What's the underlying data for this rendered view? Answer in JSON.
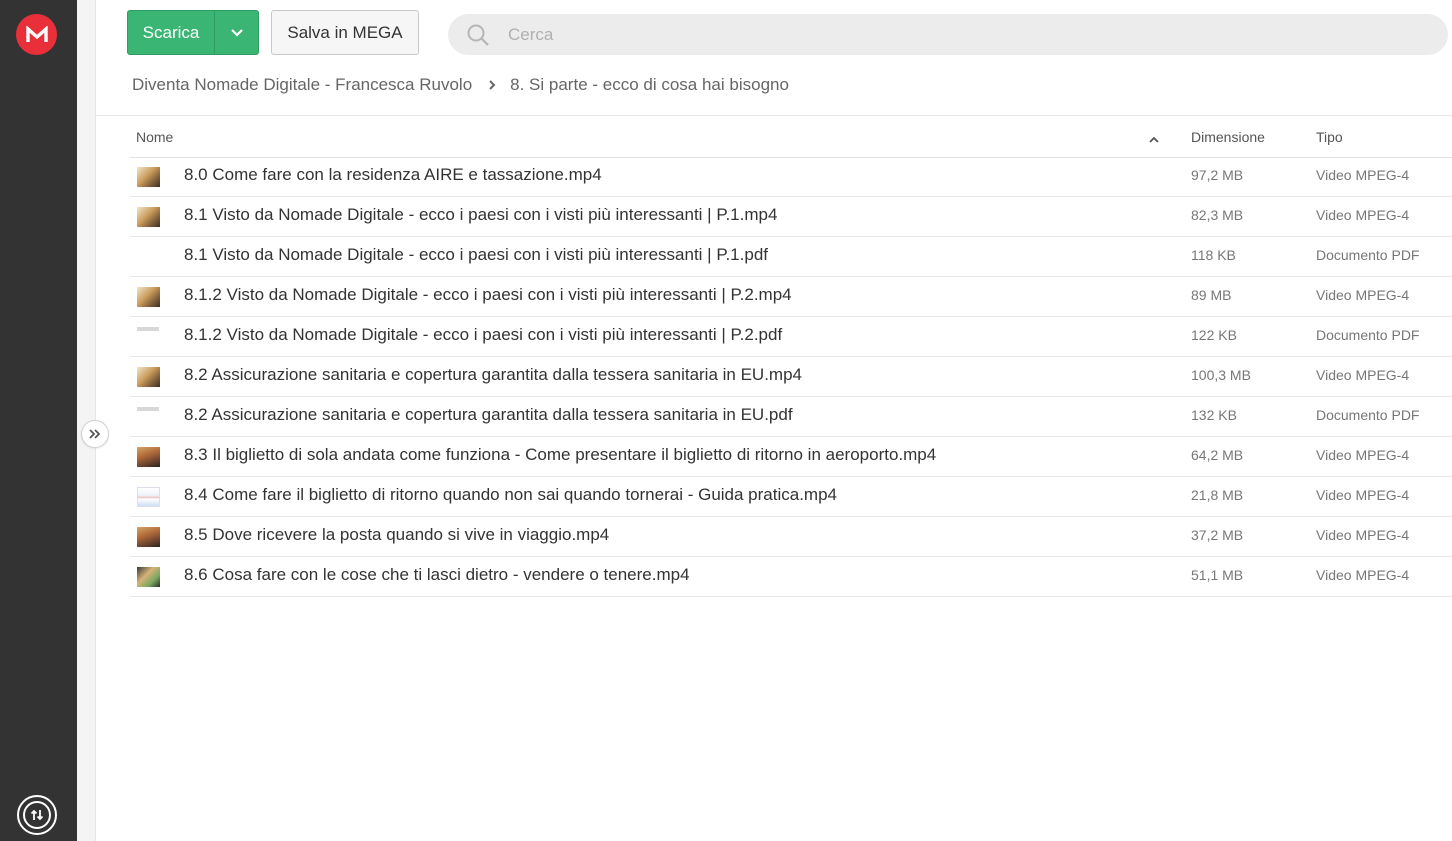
{
  "toolbar": {
    "download_label": "Scarica",
    "save_label": "Salva in MEGA",
    "search_placeholder": "Cerca"
  },
  "breadcrumb": {
    "root": "Diventa Nomade Digitale - Francesca Ruvolo",
    "current": "8. Si parte - ecco di cosa hai bisogno"
  },
  "table": {
    "headers": {
      "name": "Nome",
      "size": "Dimensione",
      "type": "Tipo"
    },
    "sort": "ascending",
    "rows": [
      {
        "name": "8.0 Come fare con la residenza AIRE e tassazione.mp4",
        "size": "97,2 MB",
        "type": "Video MPEG-4",
        "thumb": "video"
      },
      {
        "name": "8.1 Visto da Nomade Digitale - ecco i paesi con i visti più interessanti | P.1.mp4",
        "size": "82,3 MB",
        "type": "Video MPEG-4",
        "thumb": "video"
      },
      {
        "name": "8.1 Visto da Nomade Digitale - ecco i paesi con i visti più interessanti | P.1.pdf",
        "size": "118 KB",
        "type": "Documento PDF",
        "thumb": "none"
      },
      {
        "name": "8.1.2 Visto da Nomade Digitale - ecco i paesi con i visti più interessanti | P.2.mp4",
        "size": "89 MB",
        "type": "Video MPEG-4",
        "thumb": "video"
      },
      {
        "name": "8.1.2 Visto da Nomade Digitale - ecco i paesi con i visti più interessanti | P.2.pdf",
        "size": "122 KB",
        "type": "Documento PDF",
        "thumb": "pdf"
      },
      {
        "name": "8.2 Assicurazione sanitaria e copertura garantita dalla tessera sanitaria in EU.mp4",
        "size": "100,3 MB",
        "type": "Video MPEG-4",
        "thumb": "video"
      },
      {
        "name": "8.2 Assicurazione sanitaria e copertura garantita dalla tessera sanitaria in EU.pdf",
        "size": "132 KB",
        "type": "Documento PDF",
        "thumb": "pdf"
      },
      {
        "name": "8.3 Il biglietto di sola andata come funziona - Come presentare il biglietto di ritorno in aeroporto.mp4",
        "size": "64,2 MB",
        "type": "Video MPEG-4",
        "thumb": "video2"
      },
      {
        "name": "8.4 Come fare il biglietto di ritorno quando non sai quando tornerai - Guida pratica.mp4",
        "size": "21,8 MB",
        "type": "Video MPEG-4",
        "thumb": "video3"
      },
      {
        "name": "8.5 Dove ricevere la posta quando si vive in viaggio.mp4",
        "size": "37,2 MB",
        "type": "Video MPEG-4",
        "thumb": "video2"
      },
      {
        "name": "8.6 Cosa fare con le cose che ti lasci dietro - vendere o tenere.mp4",
        "size": "51,1 MB",
        "type": "Video MPEG-4",
        "thumb": "video4"
      }
    ]
  },
  "colors": {
    "brand": "#e9303a",
    "download_button": "#3bb574",
    "rail": "#333333"
  },
  "icons": {
    "logo": "mega-logo-icon",
    "download_arrow": "chevron-down-icon",
    "search": "search-icon",
    "breadcrumb_separator": "chevron-right-icon",
    "sort": "chevron-up-icon",
    "expand": "double-chevron-right-icon",
    "transfers": "transfer-icon"
  }
}
